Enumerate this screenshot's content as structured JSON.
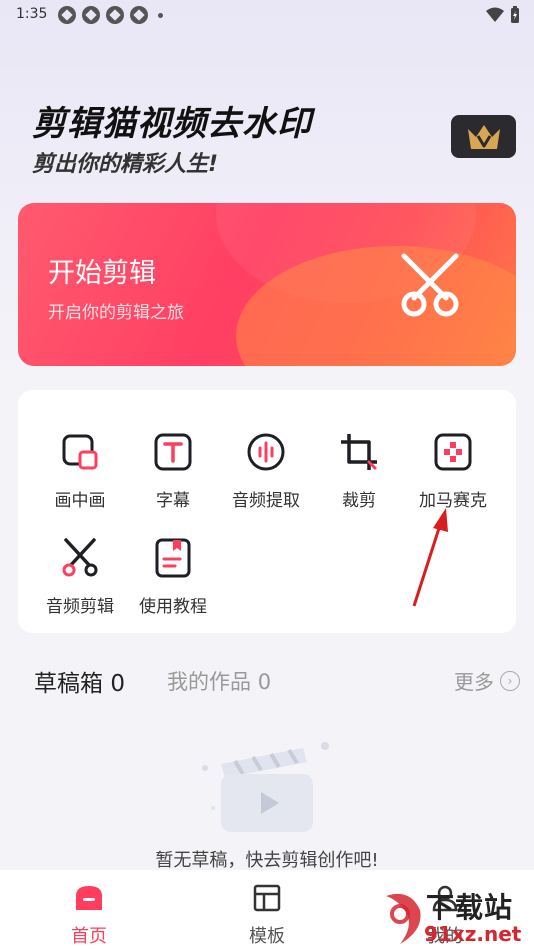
{
  "status_bar": {
    "time": "1:35"
  },
  "header": {
    "title": "剪辑猫视频去水印",
    "subtitle": "剪出你的精彩人生!",
    "vip_icon": "crown-icon"
  },
  "hero": {
    "title": "开始剪辑",
    "subtitle": "开启你的剪辑之旅",
    "icon": "scissors-icon"
  },
  "tools": [
    {
      "label": "画中画",
      "icon": "picture-in-picture-icon"
    },
    {
      "label": "字幕",
      "icon": "text-icon"
    },
    {
      "label": "音频提取",
      "icon": "audio-wave-icon"
    },
    {
      "label": "裁剪",
      "icon": "crop-icon"
    },
    {
      "label": "加马赛克",
      "icon": "mosaic-icon"
    },
    {
      "label": "音频剪辑",
      "icon": "scissors-icon"
    },
    {
      "label": "使用教程",
      "icon": "tutorial-book-icon"
    }
  ],
  "drafts": {
    "tab_drafts": "草稿箱",
    "drafts_count": "0",
    "tab_works": "我的作品",
    "works_count": "0",
    "more": "更多",
    "empty_text": "暂无草稿，快去剪辑创作吧!"
  },
  "bottom_nav": {
    "home": "首页",
    "template": "模板",
    "mine": "我的"
  },
  "watermark": {
    "site": "下载站",
    "url": "91xz.net"
  },
  "colors": {
    "accent": "#ff3d5c",
    "icon_red": "#ff3d5c",
    "icon_dark": "#1e1e24"
  }
}
